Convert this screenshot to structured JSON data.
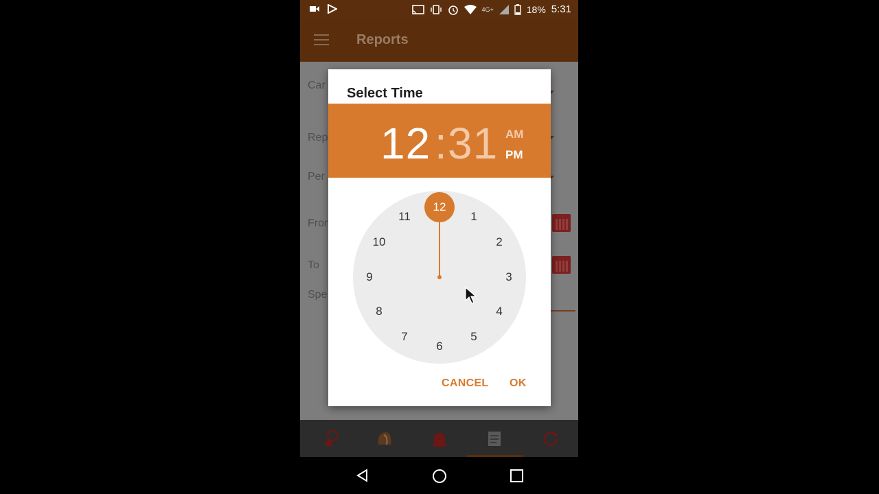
{
  "status_bar": {
    "battery": "18%",
    "time": "5:31",
    "network_label": "4G+"
  },
  "app_bar": {
    "title": "Reports",
    "menu_icon": "hamburger-menu-icon"
  },
  "background_form": {
    "labels": [
      "Car",
      "Rep",
      "Per",
      "From",
      "To",
      "Spe"
    ]
  },
  "dialog": {
    "title": "Select Time",
    "hour": "12",
    "separator": ":",
    "minute": "31",
    "am_label": "AM",
    "pm_label": "PM",
    "selected_period": "PM",
    "selected_hour": "12",
    "clock_numbers": [
      "12",
      "1",
      "2",
      "3",
      "4",
      "5",
      "6",
      "7",
      "8",
      "9",
      "10",
      "11"
    ],
    "cancel_label": "CANCEL",
    "ok_label": "OK"
  },
  "bottom_nav": {
    "items": [
      "dashboard-icon",
      "helmet-icon",
      "alarm-bell-icon",
      "reports-icon",
      "history-24-icon"
    ],
    "active_index": 3
  },
  "system_nav": [
    "back-icon",
    "home-icon",
    "recents-icon"
  ],
  "colors": {
    "accent": "#d87a2d",
    "appbar": "#5a2e0c",
    "statusbar": "#5b2f0d"
  }
}
